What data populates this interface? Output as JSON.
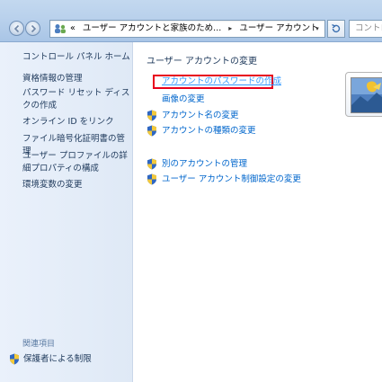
{
  "address_bar": {
    "overflow_chevron": "«",
    "breadcrumb_1": "ユーザー アカウントと家族のため...",
    "breadcrumb_sep": "▸",
    "breadcrumb_2": "ユーザー アカウント",
    "dropdown_arrow": "▾"
  },
  "search": {
    "placeholder": "コントロール パネ"
  },
  "sidebar": {
    "home_label": "コントロール パネル ホーム",
    "items": [
      {
        "label": "資格情報の管理"
      },
      {
        "label": "パスワード リセット ディスクの作成"
      },
      {
        "label": "オンライン ID をリンク"
      },
      {
        "label": "ファイル暗号化証明書の管理"
      },
      {
        "label": "ユーザー プロファイルの詳細プロパティの構成"
      },
      {
        "label": "環境変数の変更"
      }
    ],
    "related_heading": "関連項目",
    "related_items": [
      {
        "label": "保護者による制限",
        "icon": "uac-shield-icon"
      }
    ]
  },
  "main": {
    "title": "ユーザー アカウントの変更",
    "tasks": [
      {
        "label": "アカウントのパスワードの作成",
        "shield": false,
        "highlighted": true
      },
      {
        "label": "画像の変更",
        "shield": false
      },
      {
        "label": "アカウント名の変更",
        "shield": true
      },
      {
        "label": "アカウントの種類の変更",
        "shield": true
      }
    ],
    "more_tasks": [
      {
        "label": "別のアカウントの管理",
        "shield": true
      },
      {
        "label": "ユーザー アカウント制御設定の変更",
        "shield": true
      }
    ]
  },
  "colors": {
    "link": "#0066cc",
    "highlight_border": "#e8001c",
    "sidebar_text": "#1e395b"
  }
}
